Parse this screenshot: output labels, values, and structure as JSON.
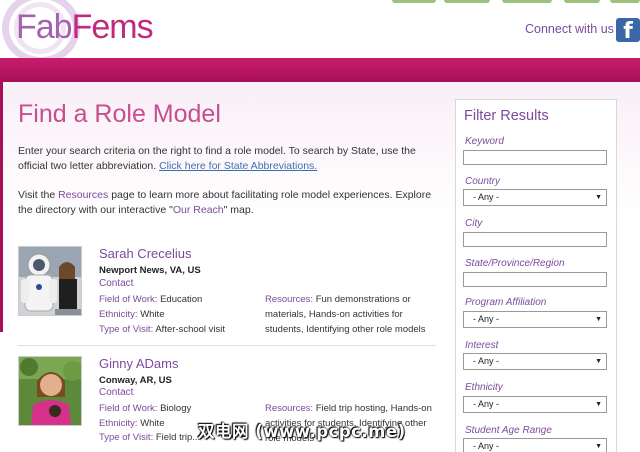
{
  "header": {
    "logo_part1": "Fab",
    "logo_part2": "Fems",
    "connect_label": "Connect with us",
    "facebook_glyph": "f"
  },
  "page": {
    "title": "Find a Role Model",
    "intro_text": "Enter your search criteria on the right to find a role model. To search by State, use the official two letter abbreviation. ",
    "intro_link": "Click here for State Abbreviations.",
    "visit_text_1": "Visit the ",
    "visit_link_resources": "Resources",
    "visit_text_2": " page to learn more about facilitating role model experiences. Explore the directory with our interactive \"",
    "visit_link_reach": "Our Reach",
    "visit_text_3": "\" map."
  },
  "labels": {
    "field_of_work": "Field of Work:",
    "ethnicity": "Ethnicity:",
    "type_of_visit": "Type of Visit:",
    "resources": "Resources:",
    "contact": "Contact"
  },
  "role_models": [
    {
      "name": "Sarah Crecelius",
      "location": "Newport News, VA, US",
      "field_of_work": "Education",
      "ethnicity": "White",
      "type_of_visit": "After-school visit",
      "resources": "Fun demonstrations or materials, Hands-on activities for students, Identifying other role models"
    },
    {
      "name": "Ginny ADams",
      "location": "Conway, AR, US",
      "field_of_work": "Biology",
      "ethnicity": "White",
      "type_of_visit": "Field trip...",
      "resources": "Field trip hosting, Hands-on activities for students, Identifying other role models"
    }
  ],
  "filter": {
    "title": "Filter Results",
    "keyword_label": "Keyword",
    "country_label": "Country",
    "country_value": "- Any -",
    "city_label": "City",
    "state_label": "State/Province/Region",
    "program_label": "Program Affiliation",
    "program_value": "- Any -",
    "interest_label": "Interest",
    "interest_value": "- Any -",
    "ethnicity_label": "Ethnicity",
    "ethnicity_value": "- Any -",
    "age_label": "Student Age Range",
    "age_value": "- Any -",
    "select_arrow": "▼"
  },
  "watermark": "双电网 (www.pcpc.me)",
  "colors": {
    "brand_purple": "#7d4a9c",
    "brand_pink": "#c81c6d",
    "title_pink": "#c84f8e",
    "link_blue": "#3d6fae"
  }
}
